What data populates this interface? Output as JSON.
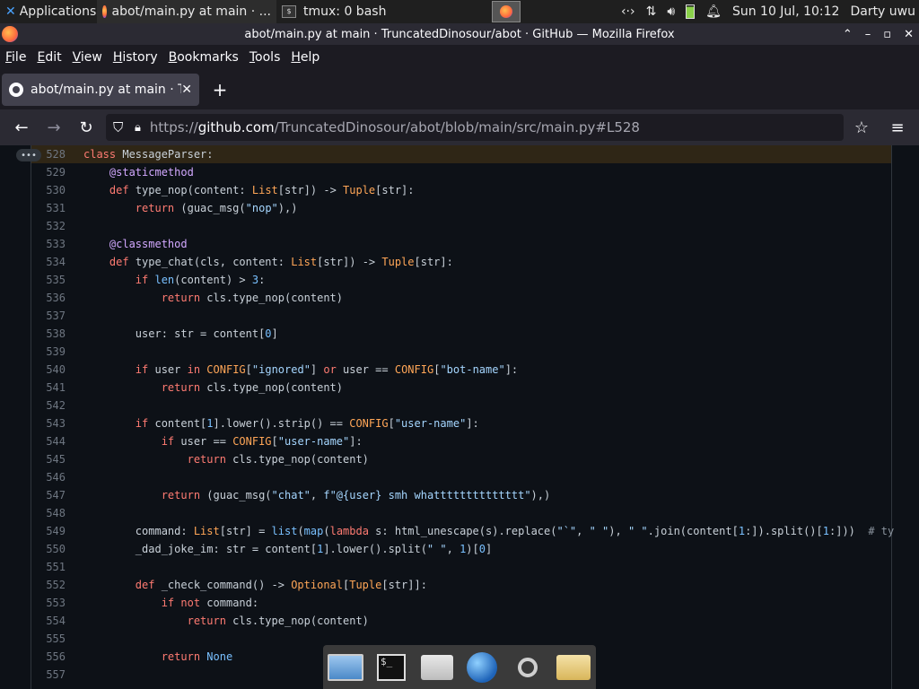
{
  "panel": {
    "apps_label": "Applications",
    "tasks": [
      {
        "label": "abot/main.py at main · ..."
      },
      {
        "label": "tmux: 0 bash"
      }
    ],
    "datetime": "Sun 10 Jul, 10:12",
    "user": "Darty uwu"
  },
  "window": {
    "title": "abot/main.py at main · TruncatedDinosour/abot · GitHub — Mozilla Firefox"
  },
  "menu": [
    "File",
    "Edit",
    "View",
    "History",
    "Bookmarks",
    "Tools",
    "Help"
  ],
  "tab": {
    "title": "abot/main.py at main · TruncatedDinosour/abot"
  },
  "url": {
    "scheme": "https://",
    "host": "github.com",
    "path": "/TruncatedDinosour/abot/blob/main/src/main.py#L528"
  },
  "code": {
    "lines": [
      {
        "n": "528",
        "t": "class MessageParser:"
      },
      {
        "n": "529",
        "t": "    @staticmethod"
      },
      {
        "n": "530",
        "t": "    def type_nop(content: List[str]) -> Tuple[str]:"
      },
      {
        "n": "531",
        "t": "        return (guac_msg(\"nop\"),)"
      },
      {
        "n": "532",
        "t": ""
      },
      {
        "n": "533",
        "t": "    @classmethod"
      },
      {
        "n": "534",
        "t": "    def type_chat(cls, content: List[str]) -> Tuple[str]:"
      },
      {
        "n": "535",
        "t": "        if len(content) > 3:"
      },
      {
        "n": "536",
        "t": "            return cls.type_nop(content)"
      },
      {
        "n": "537",
        "t": ""
      },
      {
        "n": "538",
        "t": "        user: str = content[0]"
      },
      {
        "n": "539",
        "t": ""
      },
      {
        "n": "540",
        "t": "        if user in CONFIG[\"ignored\"] or user == CONFIG[\"bot-name\"]:"
      },
      {
        "n": "541",
        "t": "            return cls.type_nop(content)"
      },
      {
        "n": "542",
        "t": ""
      },
      {
        "n": "543",
        "t": "        if content[1].lower().strip() == CONFIG[\"user-name\"]:"
      },
      {
        "n": "544",
        "t": "            if user == CONFIG[\"user-name\"]:"
      },
      {
        "n": "545",
        "t": "                return cls.type_nop(content)"
      },
      {
        "n": "546",
        "t": ""
      },
      {
        "n": "547",
        "t": "            return (guac_msg(\"chat\", f\"@{user} smh whatttttttttttttt\"),)"
      },
      {
        "n": "548",
        "t": ""
      },
      {
        "n": "549",
        "t": "        command: List[str] = list(map(lambda s: html_unescape(s).replace(\"`\", \" \"), \" \".join(content[1:]).split()[1:]))  # ty"
      },
      {
        "n": "550",
        "t": "        _dad_joke_im: str = content[1].lower().split(\" \", 1)[0]"
      },
      {
        "n": "551",
        "t": ""
      },
      {
        "n": "552",
        "t": "        def _check_command() -> Optional[Tuple[str]]:"
      },
      {
        "n": "553",
        "t": "            if not command:"
      },
      {
        "n": "554",
        "t": "                return cls.type_nop(content)"
      },
      {
        "n": "555",
        "t": ""
      },
      {
        "n": "556",
        "t": "            return None"
      },
      {
        "n": "557",
        "t": ""
      }
    ]
  }
}
